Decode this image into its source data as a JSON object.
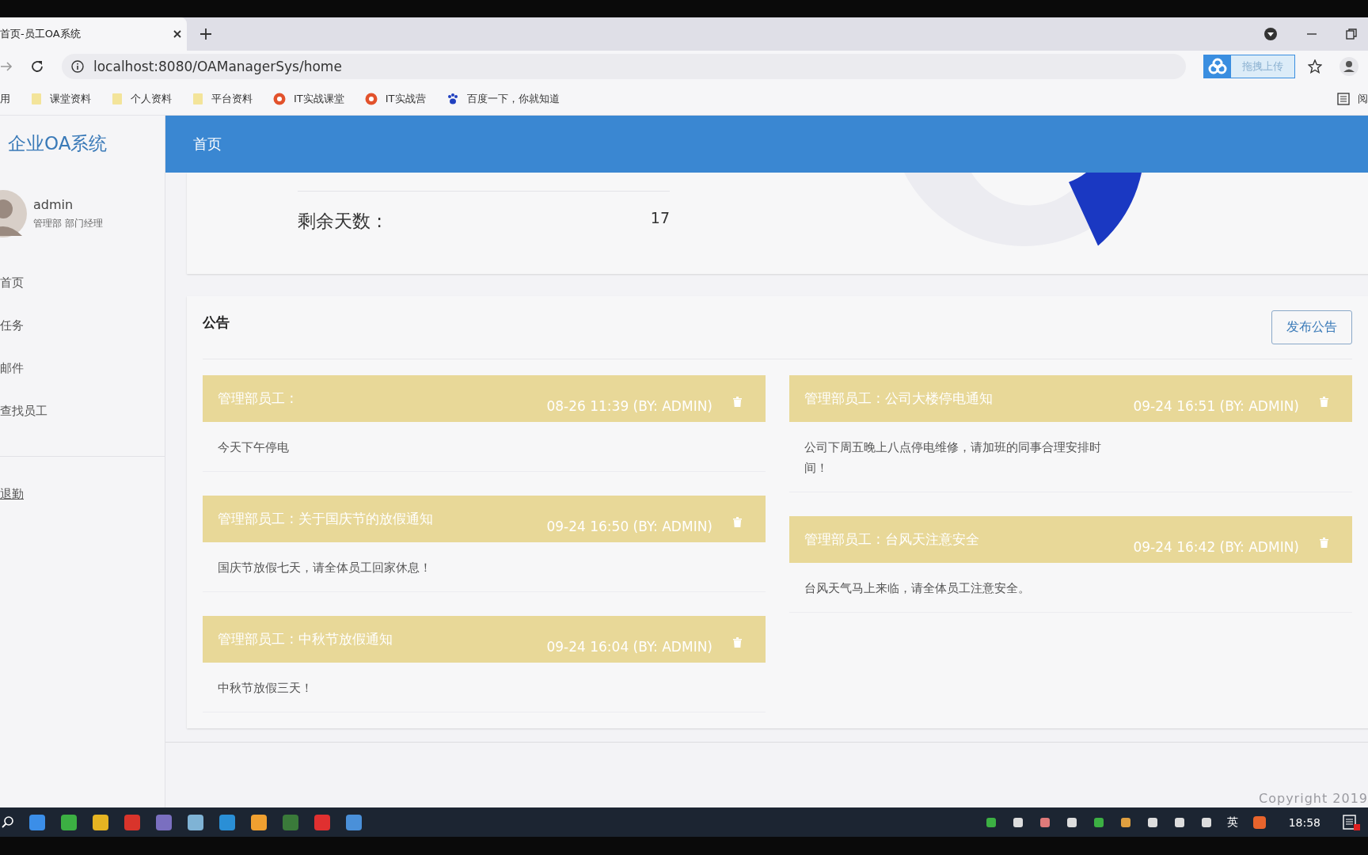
{
  "browser": {
    "tab_title": "首页-员工OA系统",
    "url": "localhost:8080/OAManagerSys/home",
    "extension": "拖拽上传",
    "bookmarks": [
      {
        "label": "用",
        "kind": "apps"
      },
      {
        "label": "课堂资料",
        "kind": "folder"
      },
      {
        "label": "个人资料",
        "kind": "folder"
      },
      {
        "label": "平台资料",
        "kind": "folder"
      },
      {
        "label": "IT实战课堂",
        "kind": "site"
      },
      {
        "label": "IT实战营",
        "kind": "site"
      },
      {
        "label": "百度一下，你就知道",
        "kind": "paw"
      }
    ],
    "reading_list": "阅"
  },
  "sidebar": {
    "brand": "企业OA系统",
    "user": {
      "name": "admin",
      "role": "管理部 部门经理"
    },
    "nav": [
      "首页",
      "任务",
      "邮件",
      "查找员工"
    ],
    "logout": "退勤"
  },
  "header": {
    "title": "首页"
  },
  "stats": {
    "label": "剩余天数 :",
    "value": "17"
  },
  "notices": {
    "title": "公告",
    "button": "发布公告",
    "columns": [
      [
        {
          "title": "管理部员工 :",
          "time": "08-26 11:39 (BY: ADMIN)",
          "body": "今天下午停电"
        },
        {
          "title": "管理部员工 : 关于国庆节的放假通知",
          "time": "09-24 16:50 (BY: ADMIN)",
          "body": "国庆节放假七天，请全体员工回家休息！"
        },
        {
          "title": "管理部员工 : 中秋节放假通知",
          "time": "09-24 16:04 (BY: ADMIN)",
          "body": "中秋节放假三天！"
        }
      ],
      [
        {
          "title": "管理部员工 : 公司大楼停电通知",
          "time": "09-24 16:51 (BY: ADMIN)",
          "body": "公司下周五晚上八点停电维修，请加班的同事合理安排时间！"
        },
        {
          "title": "管理部员工 : 台风天注意安全",
          "time": "09-24 16:42 (BY: ADMIN)",
          "body": "台风天气马上来临，请全体员工注意安全。"
        }
      ]
    ]
  },
  "footer": {
    "copyright": "Copyright 2019"
  },
  "taskbar": {
    "ime": "英",
    "clock": "18:58"
  }
}
